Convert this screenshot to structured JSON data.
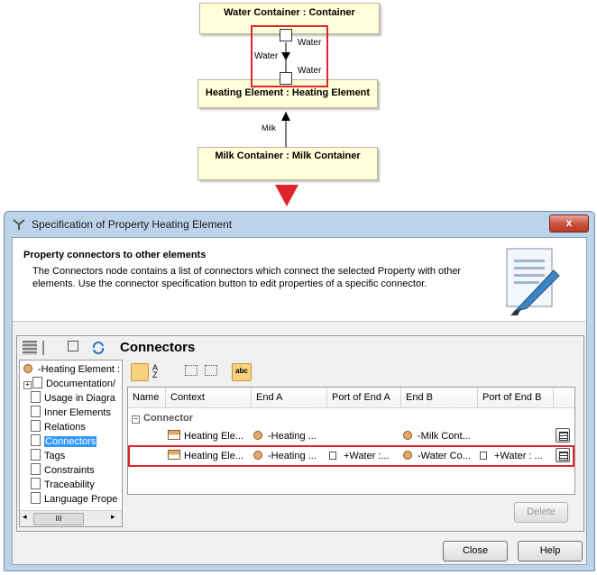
{
  "diagram": {
    "water_container": "Water Container : Container",
    "heating_element": "Heating Element : Heating Element",
    "milk_container": "Milk Container : Milk Container",
    "port_top_label": "Water",
    "port_bottom_label": "Water",
    "connector_label": "Water",
    "milk_connector_label": "Milk"
  },
  "window": {
    "title": "Specification of Property Heating Element",
    "close_glyph": "x",
    "heading": "Property connectors to other elements",
    "description": "The Connectors node contains a list of connectors which connect the selected Property with other elements. Use the connector specification button to edit properties of a specific connector.",
    "panel_title": "Connectors",
    "tree": {
      "root": "-Heating Element : H",
      "items": [
        "Documentation/",
        "Usage in Diagra",
        "Inner Elements",
        "Relations",
        "Connectors",
        "Tags",
        "Constraints",
        "Traceability",
        "Language Prope"
      ],
      "selected": "Connectors"
    },
    "table": {
      "columns": [
        "Name",
        "Context",
        "End A",
        "Port of End A",
        "End B",
        "Port of End B"
      ],
      "group": "Connector",
      "rows": [
        {
          "context": "Heating Ele...",
          "end_a": "-Heating ...",
          "port_a": "",
          "end_b": "-Milk Cont...",
          "port_b": ""
        },
        {
          "context": "Heating Ele...",
          "end_a": "-Heating ...",
          "port_a": "+Water :...",
          "end_b": "-Water Co...",
          "port_b": "+Water : ..."
        }
      ]
    },
    "buttons": {
      "delete": "Delete",
      "close": "Close",
      "help": "Help"
    },
    "toolbar_abc": "abc",
    "scroll_thumb": "III"
  },
  "colors": {
    "highlight": "#e0242b",
    "part_fill": "#ffffd9",
    "selection": "#3399ff"
  }
}
